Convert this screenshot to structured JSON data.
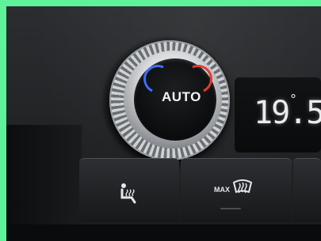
{
  "climate_control": {
    "knob_label": "AUTO",
    "temperature": "19.5",
    "temperature_unit": "°",
    "max_label": "MAX",
    "cool_color": "#3f6dff",
    "warm_color": "#e23a2f"
  },
  "buttons": [
    {
      "icon": "heated-seat-icon"
    },
    {
      "icon": "defrost-icon"
    }
  ]
}
